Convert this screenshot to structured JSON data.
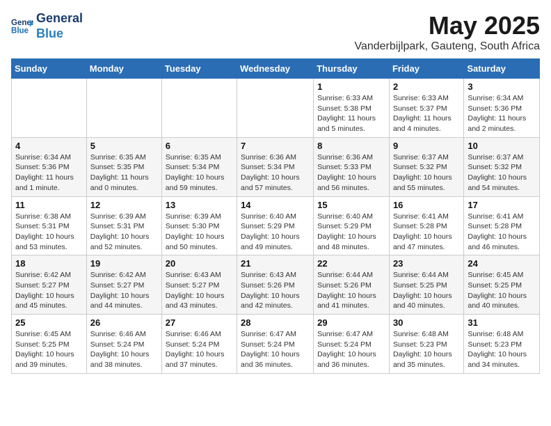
{
  "header": {
    "logo_line1": "General",
    "logo_line2": "Blue",
    "month_title": "May 2025",
    "location": "Vanderbijlpark, Gauteng, South Africa"
  },
  "days_of_week": [
    "Sunday",
    "Monday",
    "Tuesday",
    "Wednesday",
    "Thursday",
    "Friday",
    "Saturday"
  ],
  "weeks": [
    [
      {
        "day": "",
        "info": ""
      },
      {
        "day": "",
        "info": ""
      },
      {
        "day": "",
        "info": ""
      },
      {
        "day": "",
        "info": ""
      },
      {
        "day": "1",
        "info": "Sunrise: 6:33 AM\nSunset: 5:38 PM\nDaylight: 11 hours\nand 5 minutes."
      },
      {
        "day": "2",
        "info": "Sunrise: 6:33 AM\nSunset: 5:37 PM\nDaylight: 11 hours\nand 4 minutes."
      },
      {
        "day": "3",
        "info": "Sunrise: 6:34 AM\nSunset: 5:36 PM\nDaylight: 11 hours\nand 2 minutes."
      }
    ],
    [
      {
        "day": "4",
        "info": "Sunrise: 6:34 AM\nSunset: 5:36 PM\nDaylight: 11 hours\nand 1 minute."
      },
      {
        "day": "5",
        "info": "Sunrise: 6:35 AM\nSunset: 5:35 PM\nDaylight: 11 hours\nand 0 minutes."
      },
      {
        "day": "6",
        "info": "Sunrise: 6:35 AM\nSunset: 5:34 PM\nDaylight: 10 hours\nand 59 minutes."
      },
      {
        "day": "7",
        "info": "Sunrise: 6:36 AM\nSunset: 5:34 PM\nDaylight: 10 hours\nand 57 minutes."
      },
      {
        "day": "8",
        "info": "Sunrise: 6:36 AM\nSunset: 5:33 PM\nDaylight: 10 hours\nand 56 minutes."
      },
      {
        "day": "9",
        "info": "Sunrise: 6:37 AM\nSunset: 5:32 PM\nDaylight: 10 hours\nand 55 minutes."
      },
      {
        "day": "10",
        "info": "Sunrise: 6:37 AM\nSunset: 5:32 PM\nDaylight: 10 hours\nand 54 minutes."
      }
    ],
    [
      {
        "day": "11",
        "info": "Sunrise: 6:38 AM\nSunset: 5:31 PM\nDaylight: 10 hours\nand 53 minutes."
      },
      {
        "day": "12",
        "info": "Sunrise: 6:39 AM\nSunset: 5:31 PM\nDaylight: 10 hours\nand 52 minutes."
      },
      {
        "day": "13",
        "info": "Sunrise: 6:39 AM\nSunset: 5:30 PM\nDaylight: 10 hours\nand 50 minutes."
      },
      {
        "day": "14",
        "info": "Sunrise: 6:40 AM\nSunset: 5:29 PM\nDaylight: 10 hours\nand 49 minutes."
      },
      {
        "day": "15",
        "info": "Sunrise: 6:40 AM\nSunset: 5:29 PM\nDaylight: 10 hours\nand 48 minutes."
      },
      {
        "day": "16",
        "info": "Sunrise: 6:41 AM\nSunset: 5:28 PM\nDaylight: 10 hours\nand 47 minutes."
      },
      {
        "day": "17",
        "info": "Sunrise: 6:41 AM\nSunset: 5:28 PM\nDaylight: 10 hours\nand 46 minutes."
      }
    ],
    [
      {
        "day": "18",
        "info": "Sunrise: 6:42 AM\nSunset: 5:27 PM\nDaylight: 10 hours\nand 45 minutes."
      },
      {
        "day": "19",
        "info": "Sunrise: 6:42 AM\nSunset: 5:27 PM\nDaylight: 10 hours\nand 44 minutes."
      },
      {
        "day": "20",
        "info": "Sunrise: 6:43 AM\nSunset: 5:27 PM\nDaylight: 10 hours\nand 43 minutes."
      },
      {
        "day": "21",
        "info": "Sunrise: 6:43 AM\nSunset: 5:26 PM\nDaylight: 10 hours\nand 42 minutes."
      },
      {
        "day": "22",
        "info": "Sunrise: 6:44 AM\nSunset: 5:26 PM\nDaylight: 10 hours\nand 41 minutes."
      },
      {
        "day": "23",
        "info": "Sunrise: 6:44 AM\nSunset: 5:25 PM\nDaylight: 10 hours\nand 40 minutes."
      },
      {
        "day": "24",
        "info": "Sunrise: 6:45 AM\nSunset: 5:25 PM\nDaylight: 10 hours\nand 40 minutes."
      }
    ],
    [
      {
        "day": "25",
        "info": "Sunrise: 6:45 AM\nSunset: 5:25 PM\nDaylight: 10 hours\nand 39 minutes."
      },
      {
        "day": "26",
        "info": "Sunrise: 6:46 AM\nSunset: 5:24 PM\nDaylight: 10 hours\nand 38 minutes."
      },
      {
        "day": "27",
        "info": "Sunrise: 6:46 AM\nSunset: 5:24 PM\nDaylight: 10 hours\nand 37 minutes."
      },
      {
        "day": "28",
        "info": "Sunrise: 6:47 AM\nSunset: 5:24 PM\nDaylight: 10 hours\nand 36 minutes."
      },
      {
        "day": "29",
        "info": "Sunrise: 6:47 AM\nSunset: 5:24 PM\nDaylight: 10 hours\nand 36 minutes."
      },
      {
        "day": "30",
        "info": "Sunrise: 6:48 AM\nSunset: 5:23 PM\nDaylight: 10 hours\nand 35 minutes."
      },
      {
        "day": "31",
        "info": "Sunrise: 6:48 AM\nSunset: 5:23 PM\nDaylight: 10 hours\nand 34 minutes."
      }
    ]
  ]
}
